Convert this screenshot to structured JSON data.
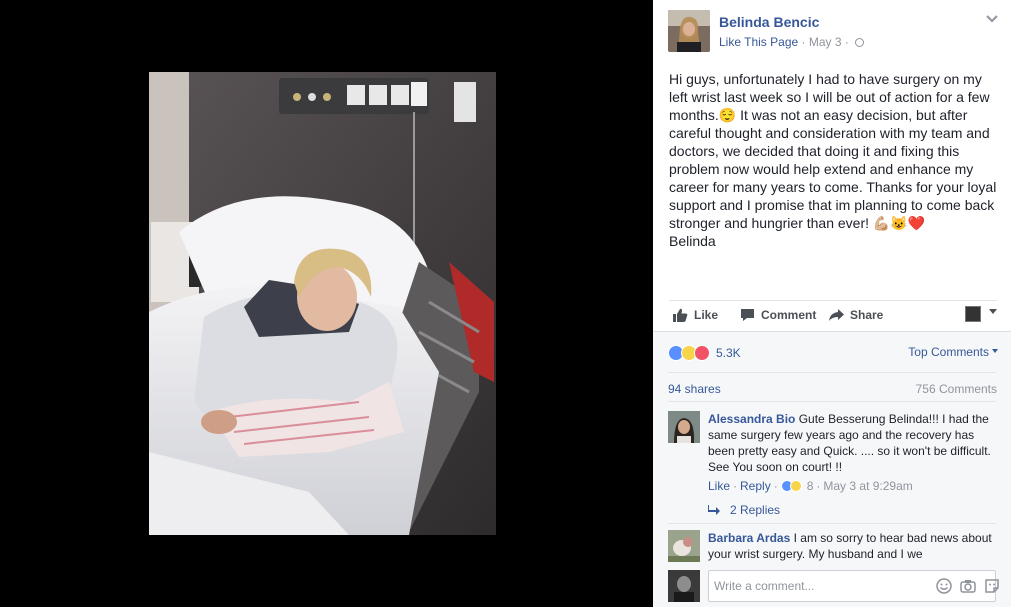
{
  "post": {
    "page_name": "Belinda Bencic",
    "like_page_label": "Like This Page",
    "date": "May 3",
    "paragraphs": [
      "Hi guys, unfortunately I had to have surgery on my left wrist last week so I will be out of action for a few months.😌 It was not an easy decision, but after careful thought and consideration with my team and doctors, we decided that doing it and fixing this problem now would help extend and enhance my career for many years to come. Thanks for your loyal support and I promise that im planning to come back stronger and hungrier than ever! 💪🏼😺❤️",
      "Belinda"
    ]
  },
  "actions": {
    "like": "Like",
    "comment": "Comment",
    "share": "Share"
  },
  "feedback": {
    "reaction_count": "5.3K",
    "top_comments_label": "Top Comments",
    "shares": "94 shares",
    "comments_count": "756 Comments"
  },
  "comments": [
    {
      "author": "Alessandra Bio",
      "text": "Gute Besserung Belinda!!! I had the same surgery few years ago and the recovery has been pretty easy and Quick. .... so it won't be difficult. See You soon on court! !!",
      "like_label": "Like",
      "reply_label": "Reply",
      "reaction_count": "8",
      "time": "May 3 at 9:29am",
      "replies_label": "2 Replies"
    },
    {
      "author": "Barbara Ardas",
      "text": "I am so sorry to hear bad news about your wrist surgery. My husband and I we"
    }
  ],
  "composer": {
    "placeholder": "Write a comment..."
  },
  "colors": {
    "link": "#365899",
    "muted": "#90949c",
    "text": "#1d2129",
    "panel_bg": "#f6f7f9"
  },
  "icons": [
    "chevron-down-icon",
    "globe-icon",
    "like-icon",
    "comment-icon",
    "share-icon",
    "reply-arrow-icon",
    "emoji-icon",
    "camera-icon",
    "sticker-icon"
  ]
}
